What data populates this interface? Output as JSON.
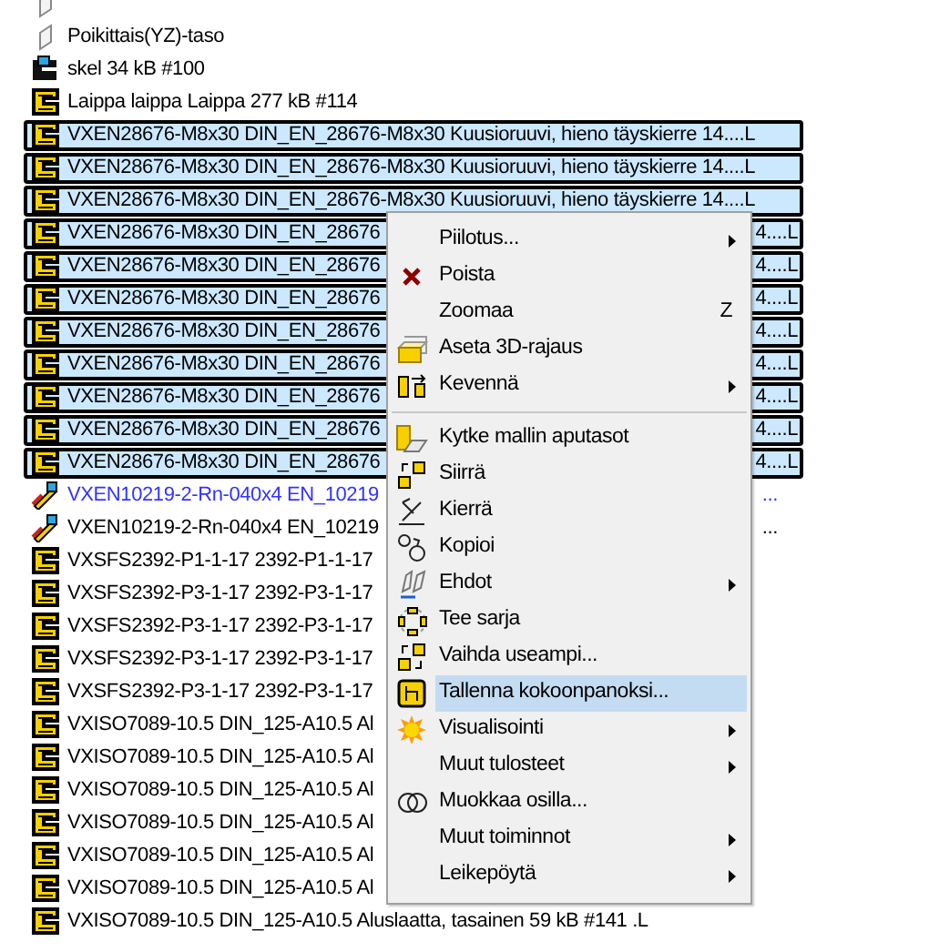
{
  "tree": {
    "rows": [
      {
        "kind": "plane",
        "selected": false
      },
      {
        "text": "Poikittais(YZ)-taso",
        "kind": "plane",
        "selected": false,
        "highlighted": false
      },
      {
        "text": "skel 34 kB #100",
        "kind": "skeleton",
        "selected": false,
        "highlighted": false
      },
      {
        "text": "Laippa laippa Laippa 277 kB #114",
        "kind": "part",
        "selected": false,
        "highlighted": false
      },
      {
        "text": "VXEN28676-M8x30 DIN_EN_28676-M8x30 Kuusioruuvi, hieno täyskierre 14....L",
        "kind": "part",
        "selected": true,
        "highlighted": false
      },
      {
        "text": "VXEN28676-M8x30 DIN_EN_28676-M8x30 Kuusioruuvi, hieno täyskierre 14....L",
        "kind": "part",
        "selected": true,
        "highlighted": false
      },
      {
        "text": "VXEN28676-M8x30 DIN_EN_28676-M8x30 Kuusioruuvi, hieno täyskierre 14....L",
        "kind": "part",
        "selected": true,
        "highlighted": false
      },
      {
        "text": "VXEN28676-M8x30 DIN_EN_28676",
        "tail": "4....L",
        "kind": "part",
        "selected": true,
        "highlighted": false
      },
      {
        "text": "VXEN28676-M8x30 DIN_EN_28676",
        "tail": "4....L",
        "kind": "part",
        "selected": true,
        "highlighted": false
      },
      {
        "text": "VXEN28676-M8x30 DIN_EN_28676",
        "tail": "4....L",
        "kind": "part",
        "selected": true,
        "highlighted": false
      },
      {
        "text": "VXEN28676-M8x30 DIN_EN_28676",
        "tail": "4....L",
        "kind": "part",
        "selected": true,
        "highlighted": false
      },
      {
        "text": "VXEN28676-M8x30 DIN_EN_28676",
        "tail": "4....L",
        "kind": "part",
        "selected": true,
        "highlighted": false
      },
      {
        "text": "VXEN28676-M8x30 DIN_EN_28676",
        "tail": "4....L",
        "kind": "part",
        "selected": true,
        "highlighted": false
      },
      {
        "text": "VXEN28676-M8x30 DIN_EN_28676",
        "tail": "4....L",
        "kind": "part",
        "selected": true,
        "highlighted": false
      },
      {
        "text": "VXEN28676-M8x30 DIN_EN_28676",
        "tail": "4....L",
        "kind": "part",
        "selected": true,
        "highlighted": false
      },
      {
        "text": "VXEN10219-2-Rn-040x4 EN_10219",
        "tail": "...",
        "kind": "weld",
        "selected": false,
        "highlighted": true
      },
      {
        "text": "VXEN10219-2-Rn-040x4 EN_10219",
        "tail": "...",
        "kind": "weld",
        "selected": false,
        "highlighted": false
      },
      {
        "text": "VXSFS2392-P1-1-17 2392-P1-1-17",
        "kind": "part",
        "selected": false,
        "highlighted": false
      },
      {
        "text": "VXSFS2392-P3-1-17 2392-P3-1-17",
        "kind": "part",
        "selected": false,
        "highlighted": false
      },
      {
        "text": "VXSFS2392-P3-1-17 2392-P3-1-17",
        "kind": "part",
        "selected": false,
        "highlighted": false
      },
      {
        "text": "VXSFS2392-P3-1-17 2392-P3-1-17",
        "kind": "part",
        "selected": false,
        "highlighted": false
      },
      {
        "text": "VXSFS2392-P3-1-17 2392-P3-1-17",
        "kind": "part",
        "selected": false,
        "highlighted": false
      },
      {
        "text": "VXISO7089-10.5 DIN_125-A10.5 Al",
        "kind": "part",
        "selected": false,
        "highlighted": false
      },
      {
        "text": "VXISO7089-10.5 DIN_125-A10.5 Al",
        "kind": "part",
        "selected": false,
        "highlighted": false
      },
      {
        "text": "VXISO7089-10.5 DIN_125-A10.5 Al",
        "kind": "part",
        "selected": false,
        "highlighted": false
      },
      {
        "text": "VXISO7089-10.5 DIN_125-A10.5 Al",
        "kind": "part",
        "selected": false,
        "highlighted": false
      },
      {
        "text": "VXISO7089-10.5 DIN_125-A10.5 Al",
        "kind": "part",
        "selected": false,
        "highlighted": false
      },
      {
        "text": "VXISO7089-10.5 DIN_125-A10.5 Al",
        "kind": "part",
        "selected": false,
        "highlighted": false
      },
      {
        "text": "VXISO7089-10.5 DIN_125-A10.5 Aluslaatta, tasainen 59 kB #141 .L",
        "kind": "part",
        "selected": false,
        "highlighted": false
      }
    ]
  },
  "context_menu": {
    "items": [
      {
        "label": "Piilotus...",
        "submenu": true,
        "selected": false
      },
      {
        "label": "Poista",
        "kind": "delete",
        "submenu": false,
        "selected": false
      },
      {
        "label": "Zoomaa",
        "shortcut": "Z",
        "submenu": false,
        "selected": false
      },
      {
        "label": "Aseta 3D-rajaus",
        "kind": "box",
        "submenu": false,
        "selected": false
      },
      {
        "label": "Kevennä",
        "kind": "lighten",
        "submenu": true,
        "selected": false
      },
      {
        "kind": "separator"
      },
      {
        "label": "Kytke mallin aputasot",
        "kind": "planes",
        "submenu": false,
        "selected": false
      },
      {
        "label": "Siirrä",
        "kind": "move",
        "submenu": false,
        "selected": false
      },
      {
        "label": "Kierrä",
        "kind": "rotate",
        "submenu": false,
        "selected": false
      },
      {
        "label": "Kopioi",
        "kind": "copy",
        "submenu": false,
        "selected": false
      },
      {
        "label": "Ehdot",
        "kind": "constraints",
        "submenu": true,
        "selected": false
      },
      {
        "label": "Tee sarja",
        "kind": "pattern",
        "submenu": false,
        "selected": false
      },
      {
        "label": "Vaihda useampi...",
        "kind": "replace",
        "submenu": false,
        "selected": false
      },
      {
        "label": "Tallenna kokoonpanoksi...",
        "kind": "assembly",
        "submenu": false,
        "selected": true
      },
      {
        "label": "Visualisointi",
        "kind": "sun",
        "submenu": true,
        "selected": false
      },
      {
        "label": "Muut tulosteet",
        "submenu": true,
        "selected": false
      },
      {
        "label": "Muokkaa osilla...",
        "kind": "rings",
        "submenu": false,
        "selected": false
      },
      {
        "label": "Muut toiminnot",
        "submenu": true,
        "selected": false
      },
      {
        "label": "Leikepöytä",
        "submenu": true,
        "selected": false
      }
    ]
  }
}
